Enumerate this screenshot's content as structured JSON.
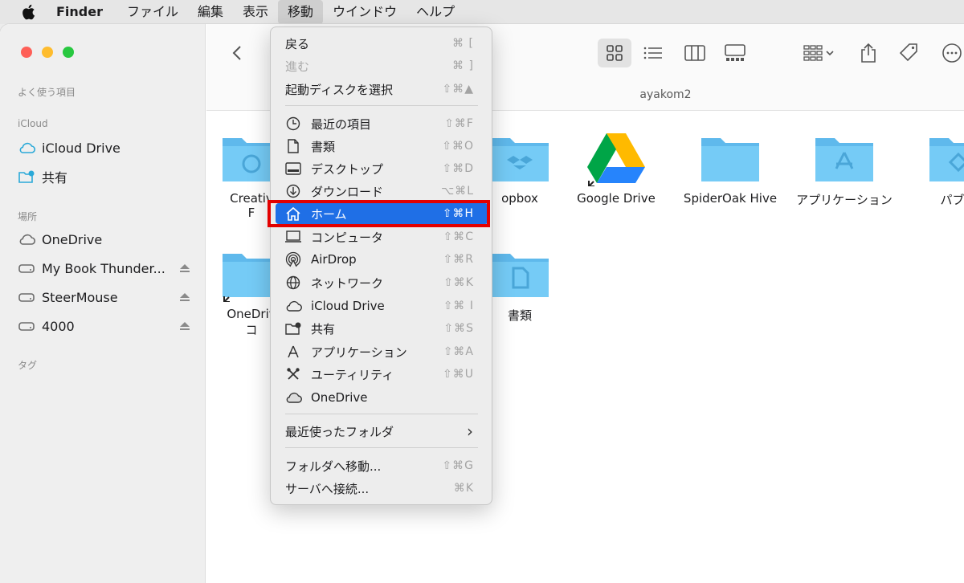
{
  "menubar": {
    "app": "Finder",
    "items": [
      "ファイル",
      "編集",
      "表示",
      "移動",
      "ウインドウ",
      "ヘルプ"
    ],
    "active_index": 3
  },
  "sidebar": {
    "favorites_header": "よく使う項目",
    "icloud_header": "iCloud",
    "icloud_items": [
      {
        "label": "iCloud Drive",
        "icon": "cloud-icon"
      },
      {
        "label": "共有",
        "icon": "shared-folder-icon"
      }
    ],
    "locations_header": "場所",
    "location_items": [
      {
        "label": "OneDrive",
        "icon": "cloud-icon"
      },
      {
        "label": "My Book Thunder...",
        "icon": "drive-icon"
      },
      {
        "label": "SteerMouse",
        "icon": "drive-icon"
      },
      {
        "label": "4000",
        "icon": "drive-icon"
      }
    ],
    "tags_header": "タグ"
  },
  "toolbar": {
    "path_title": "ayakom2"
  },
  "content": {
    "items": [
      {
        "label": "Creativ",
        "label2": "F"
      },
      {
        "label": "opbox"
      },
      {
        "label": "Google Drive"
      },
      {
        "label": "SpiderOak Hive"
      },
      {
        "label": "アプリケーション"
      },
      {
        "label": "パブリ"
      },
      {
        "label": "OneDriv",
        "label2": "コ"
      },
      {
        "label": "書類"
      }
    ]
  },
  "menu": {
    "items": [
      {
        "label": "戻る",
        "shortcut": "⌘ ["
      },
      {
        "label": "進む",
        "shortcut": "⌘ ]",
        "disabled": true
      },
      {
        "label": "起動ディスクを選択",
        "shortcut": "⇧⌘▲"
      },
      {
        "label": "最近の項目",
        "shortcut": "⇧⌘F",
        "icon": "clock-icon"
      },
      {
        "label": "書類",
        "shortcut": "⇧⌘O",
        "icon": "document-icon"
      },
      {
        "label": "デスクトップ",
        "shortcut": "⇧⌘D",
        "icon": "desktop-icon"
      },
      {
        "label": "ダウンロード",
        "shortcut": "⌥⌘L",
        "icon": "download-icon"
      },
      {
        "label": "ホーム",
        "shortcut": "⇧⌘H",
        "icon": "home-icon",
        "highlighted": true
      },
      {
        "label": "コンピュータ",
        "shortcut": "⇧⌘C",
        "icon": "computer-icon"
      },
      {
        "label": "AirDrop",
        "shortcut": "⇧⌘R",
        "icon": "airdrop-icon"
      },
      {
        "label": "ネットワーク",
        "shortcut": "⇧⌘K",
        "icon": "globe-icon"
      },
      {
        "label": "iCloud Drive",
        "shortcut": "⇧⌘ I",
        "icon": "cloud-icon"
      },
      {
        "label": "共有",
        "shortcut": "⇧⌘S",
        "icon": "shared-folder-icon"
      },
      {
        "label": "アプリケーション",
        "shortcut": "⇧⌘A",
        "icon": "applications-icon"
      },
      {
        "label": "ユーティリティ",
        "shortcut": "⇧⌘U",
        "icon": "utilities-icon"
      },
      {
        "label": "OneDrive",
        "shortcut": "",
        "icon": "cloud-icon"
      },
      {
        "label": "最近使ったフォルダ",
        "shortcut": "›"
      },
      {
        "label": "フォルダへ移動...",
        "shortcut": "⇧⌘G"
      },
      {
        "label": "サーバへ接続...",
        "shortcut": "⌘K"
      }
    ]
  },
  "colors": {
    "highlight": "#1f6fe6",
    "annotation_red": "#e30000",
    "folder_blue": "#6ac4f3"
  }
}
